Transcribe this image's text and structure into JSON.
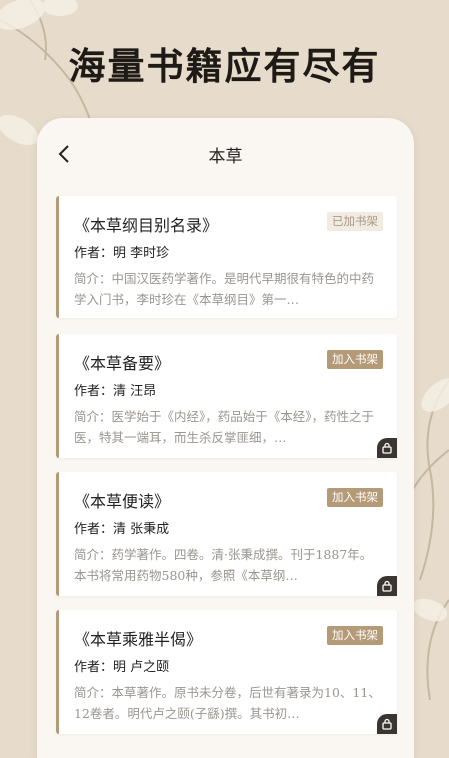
{
  "headline": "海量书籍应有尽有",
  "nav": {
    "title": "本草"
  },
  "books": [
    {
      "title": "《本草纲目别名录》",
      "author": "作者：明 李时珍",
      "badge": "已加书架",
      "badge_state": "added",
      "desc": "简介：中国汉医药学著作。是明代早期很有特色的中药学入门书，李时珍在《本草纲目》第一…",
      "locked": false
    },
    {
      "title": "《本草备要》",
      "author": "作者：清 汪昂",
      "badge": "加入书架",
      "badge_state": "add",
      "desc": "简介：医学始于《内经》，药品始于《本经》，药性之于医，特其一端耳，而生杀反掌匪细，…",
      "locked": true
    },
    {
      "title": "《本草便读》",
      "author": "作者：清 张秉成",
      "badge": "加入书架",
      "badge_state": "add",
      "desc": "简介：药学著作。四卷。清·张秉成撰。刊于1887年。本书将常用药物580种，参照《本草纲…",
      "locked": true
    },
    {
      "title": "《本草乘雅半偈》",
      "author": "作者：明 卢之颐",
      "badge": "加入书架",
      "badge_state": "add",
      "desc": "简介：本草著作。原书未分卷，后世有著录为10、11、12卷者。明代卢之颐(子繇)撰。其书初…",
      "locked": true
    }
  ]
}
